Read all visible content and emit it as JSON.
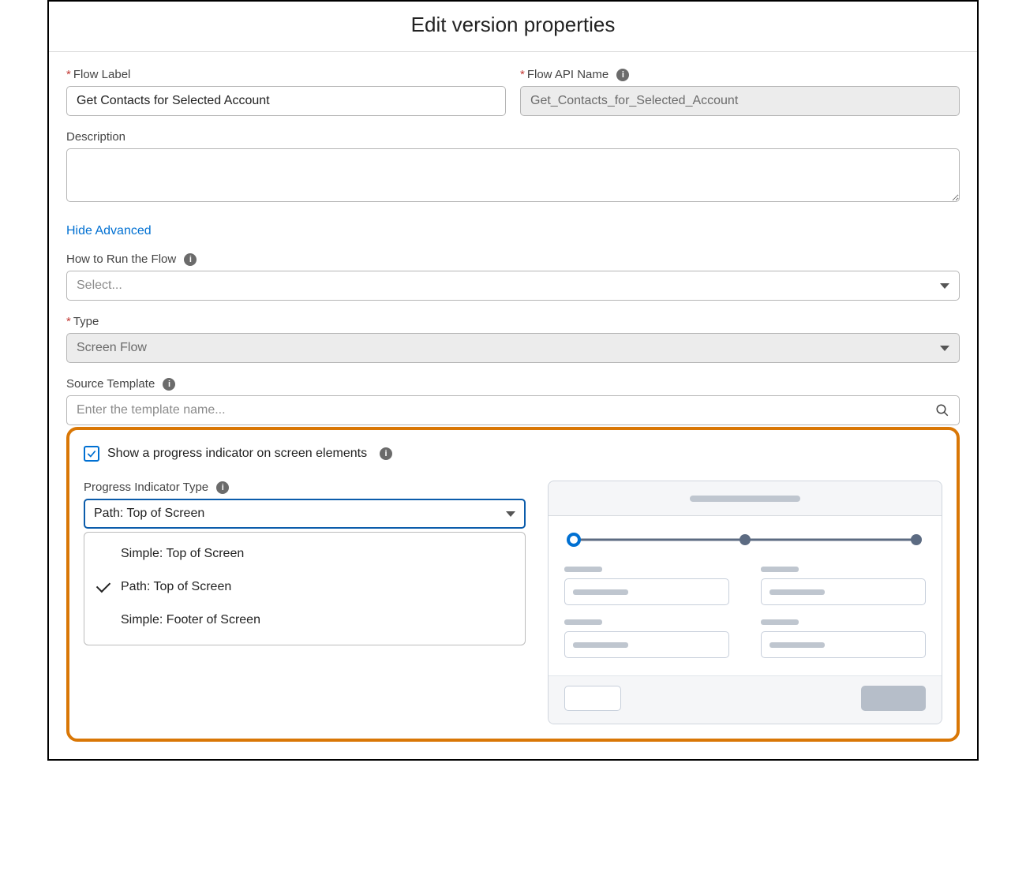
{
  "modal": {
    "title": "Edit version properties"
  },
  "fields": {
    "flow_label": {
      "label": "Flow Label",
      "value": "Get Contacts for Selected Account"
    },
    "flow_api_name": {
      "label": "Flow API Name",
      "value": "Get_Contacts_for_Selected_Account"
    },
    "description": {
      "label": "Description",
      "value": ""
    }
  },
  "advanced": {
    "toggle_label": "Hide Advanced",
    "how_to_run": {
      "label": "How to Run the Flow",
      "placeholder": "Select..."
    },
    "type": {
      "label": "Type",
      "value": "Screen Flow"
    },
    "source_template": {
      "label": "Source Template",
      "placeholder": "Enter the template name..."
    }
  },
  "progress": {
    "checkbox_label": "Show a progress indicator on screen elements",
    "checked": true,
    "type_label": "Progress Indicator Type",
    "selected": "Path: Top of Screen",
    "options": [
      "Simple: Top of Screen",
      "Path: Top of Screen",
      "Simple: Footer of Screen"
    ]
  }
}
